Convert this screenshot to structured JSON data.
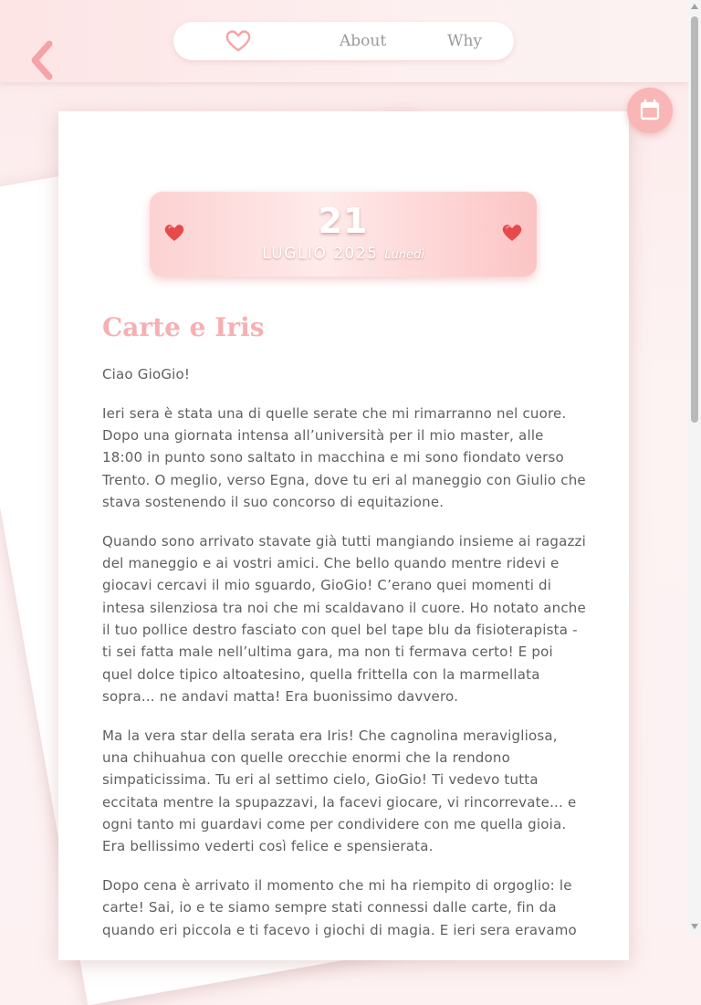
{
  "header": {
    "nav": {
      "about_label": "About",
      "why_label": "Why"
    },
    "back_icon": "chevron-left-icon",
    "home_icon": "heart-outline-icon"
  },
  "calendar_icon": "calendar-icon",
  "entry": {
    "date": {
      "day": "21",
      "month_year": "LUGLIO 2025",
      "weekday": "Lunedì"
    },
    "title": "Carte e Iris",
    "paragraphs": [
      "Ciao GioGio!",
      "Ieri sera è stata una di quelle serate che mi rimarranno nel cuore. Dopo una giornata intensa all’università per il mio master, alle 18:00 in punto sono saltato in macchina e mi sono fiondato verso Trento. O meglio, verso Egna, dove tu eri al maneggio con Giulio che stava sostenendo il suo concorso di equitazione.",
      "Quando sono arrivato stavate già tutti mangiando insieme ai ragazzi del maneggio e ai vostri amici. Che bello quando mentre ridevi e giocavi cercavi il mio sguardo, GioGio! C’erano quei momenti di intesa silenziosa tra noi che mi scaldavano il cuore. Ho notato anche il tuo pollice destro fasciato con quel bel tape blu da fisioterapista - ti sei fatta male nell’ultima gara, ma non ti fermava certo! E poi quel dolce tipico altoatesino, quella frittella con la marmellata sopra... ne andavi matta! Era buonissimo davvero.",
      "Ma la vera star della serata era Iris! Che cagnolina meravigliosa, una chihuahua con quelle orecchie enormi che la rendono simpaticissima. Tu eri al settimo cielo, GioGio! Ti vedevo tutta eccitata mentre la spupazzavi, la facevi giocare, vi rincorrevate... e ogni tanto mi guardavi come per condividere con me quella gioia. Era bellissimo vederti così felice e spensierata.",
      "Dopo cena è arrivato il momento che mi ha riempito di orgoglio: le carte! Sai, io e te siamo sempre stati connessi dalle carte, fin da quando eri piccola e ti facevo i giochi di magia. E ieri sera eravamo"
    ]
  },
  "colors": {
    "accent": "#f6b0b2",
    "background": "#fdf1f1",
    "text": "#5f5f5f",
    "heart": "#e64b4b"
  }
}
